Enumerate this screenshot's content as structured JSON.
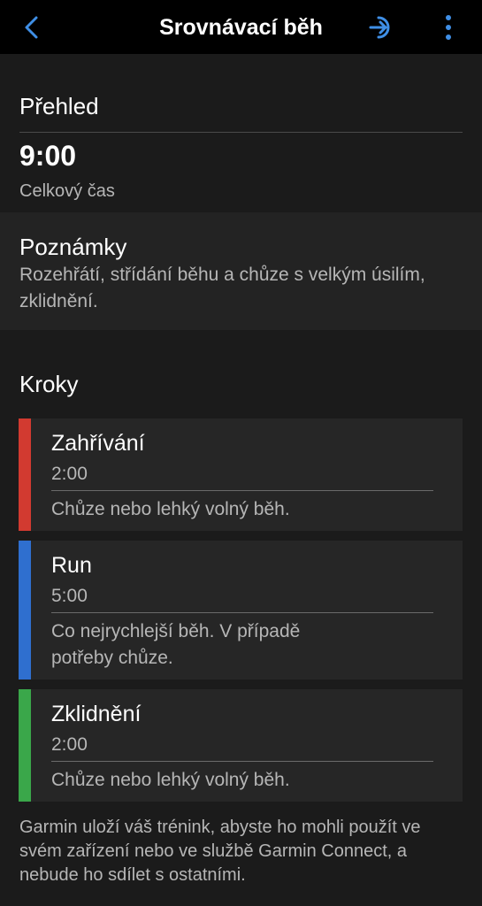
{
  "header": {
    "title": "Srovnávací běh",
    "back_icon": "chevron-left-icon",
    "export_icon": "send-to-device-icon",
    "more_icon": "more-vertical-icon",
    "accent_color": "#3f8fe6"
  },
  "overview": {
    "title": "Přehled",
    "total_time": "9:00",
    "total_time_label": "Celkový čas"
  },
  "notes": {
    "title": "Poznámky",
    "text": "Rozehřátí, střídání běhu a chůze s velkým úsilím, zklidnění."
  },
  "steps": {
    "title": "Kroky",
    "items": [
      {
        "name": "Zahřívání",
        "duration": "2:00",
        "description": "Chůze nebo lehký volný běh.",
        "color": "#d23a30"
      },
      {
        "name": "Run",
        "duration": "5:00",
        "description": "Co nejrychlejší běh. V případě potřeby chůze.",
        "color": "#2f6fcf"
      },
      {
        "name": "Zklidnění",
        "duration": "2:00",
        "description": "Chůze nebo lehký volný běh.",
        "color": "#3aa74a"
      }
    ]
  },
  "footer": {
    "text": "Garmin uloží váš trénink, abyste ho mohli použít ve svém zařízení nebo ve službě Garmin Connect, a nebude ho sdílet s ostatními."
  }
}
